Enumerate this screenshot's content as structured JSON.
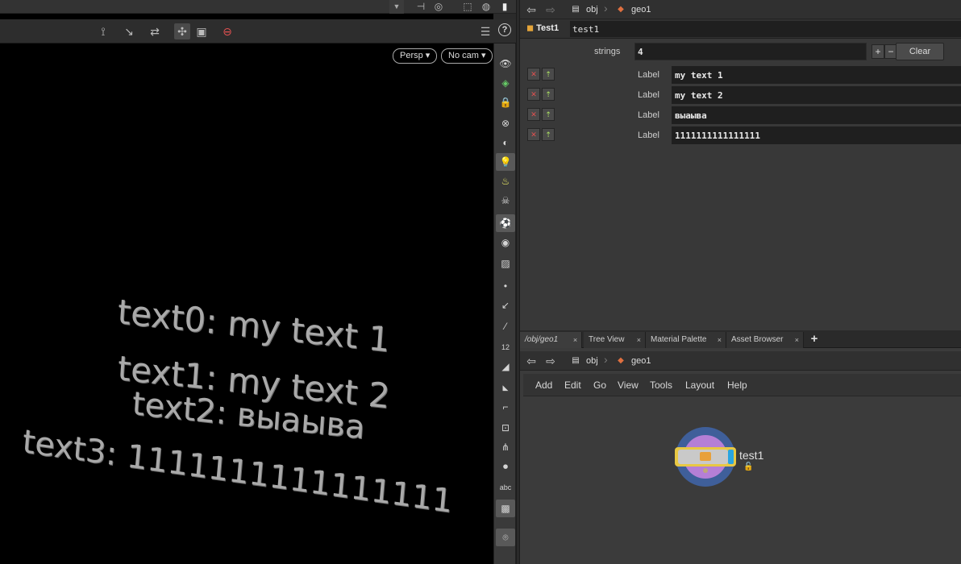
{
  "viewport": {
    "persp_label": "Persp ▾",
    "cam_label": "No cam ▾",
    "text_lines": [
      "text0: my text 1",
      "text1: my text 2",
      "text2: выаыва",
      "text3: 1111111111111111"
    ],
    "shelf_text_label": "abc",
    "shelf_num_label": "12"
  },
  "params_path": {
    "crumb1": "obj",
    "crumb2": "geo1"
  },
  "node_header": {
    "type_label": "Test1",
    "name_value": "test1"
  },
  "strings": {
    "label": "strings",
    "value": "4",
    "plus": "+",
    "minus": "−",
    "clear_label": "Clear"
  },
  "multiparm": [
    {
      "label": "Label",
      "value": "my text 1"
    },
    {
      "label": "Label",
      "value": "my text 2"
    },
    {
      "label": "Label",
      "value": "выаыва"
    },
    {
      "label": "Label",
      "value": "1111111111111111"
    }
  ],
  "network": {
    "tabs": [
      {
        "label": "/obj/geo1",
        "close": "×"
      },
      {
        "label": "Tree View",
        "close": "×"
      },
      {
        "label": "Material Palette",
        "close": "×"
      },
      {
        "label": "Asset Browser",
        "close": "×"
      }
    ],
    "add_tab": "+",
    "path": {
      "crumb1": "obj",
      "crumb2": "geo1"
    },
    "menus": [
      "Add",
      "Edit",
      "Go",
      "View",
      "Tools",
      "Layout",
      "Help"
    ],
    "node_name": "test1"
  },
  "colors": {
    "node_ring": "#3f5f9a",
    "node_inner": "#b57fd6",
    "node_flag": "#e8c843",
    "node_accent": "#2aa5e0"
  }
}
